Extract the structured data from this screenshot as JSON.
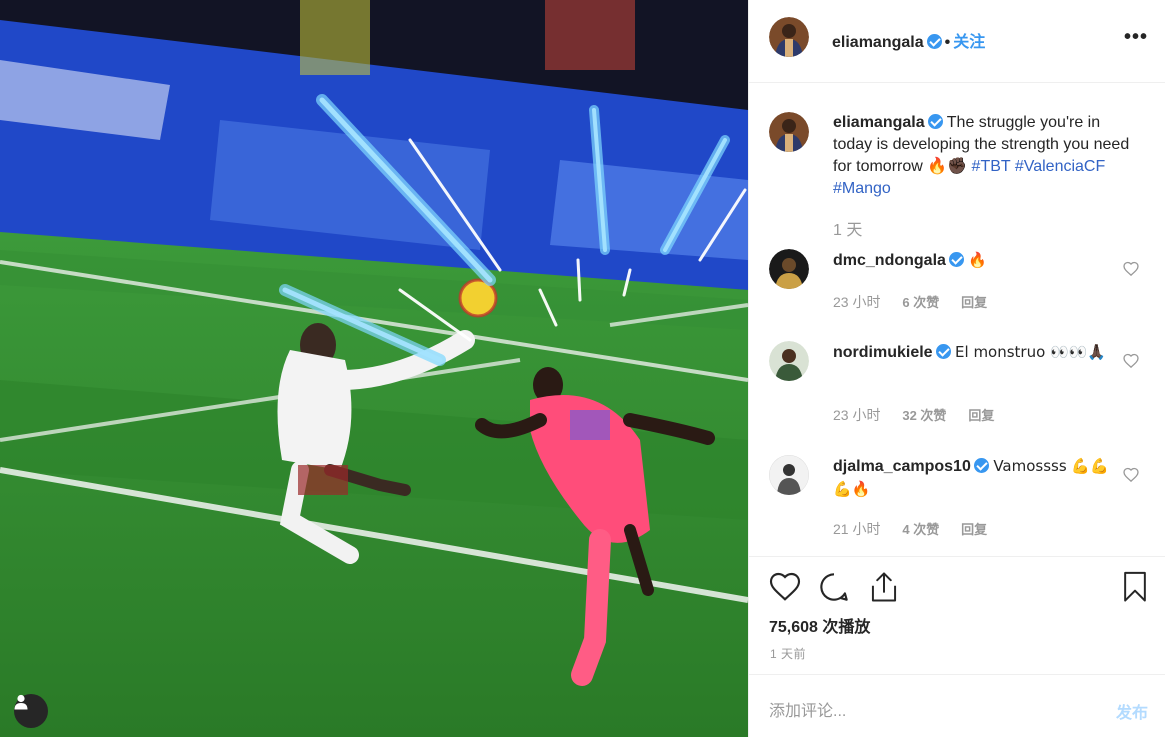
{
  "post": {
    "username": "eliamangala",
    "follow_label": "关注",
    "more_label": "•••",
    "caption_text": "The struggle you're in today is developing the strength you need for tomorrow 🔥✊🏿",
    "hashtags": [
      "#TBT",
      "#ValenciaCF",
      "#Mango"
    ],
    "caption_time": "1 天"
  },
  "comments": [
    {
      "username": "dmc_ndongala",
      "text": "🔥",
      "time": "23 小时",
      "likes": "6 次赞",
      "reply": "回复"
    },
    {
      "username": "nordimukiele",
      "text": "El monstruo 👀👀🙏🏿",
      "time": "23 小时",
      "likes": "32 次赞",
      "reply": "回复"
    },
    {
      "username": "djalma_campos10",
      "text": "Vamossss 💪💪💪🔥",
      "time": "21 小时",
      "likes": "4 次赞",
      "reply": "回复"
    }
  ],
  "stats": {
    "plays": "75,608 次播放",
    "ago": "1 天前"
  },
  "composer": {
    "placeholder": "添加评论...",
    "post_label": "发布"
  },
  "colors": {
    "link_blue": "#3897f0",
    "hashtag_blue": "#3263c5",
    "muted": "#999999",
    "pitch_green": "#2f8a2f",
    "jersey_pink": "#ff4d7a"
  },
  "icons": [
    "heart-icon",
    "comment-icon",
    "share-icon",
    "bookmark-icon",
    "verified-icon",
    "more-icon",
    "user-icon"
  ]
}
